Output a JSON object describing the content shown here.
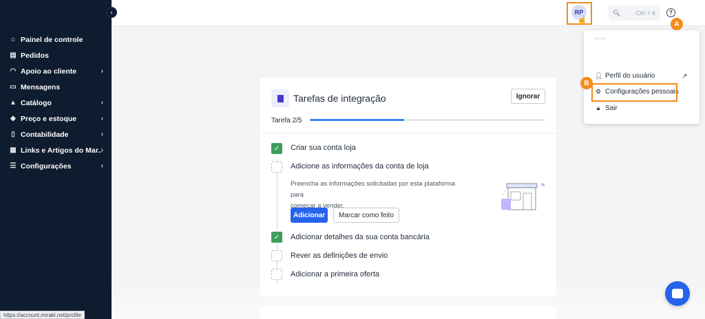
{
  "sidebar": {
    "items": [
      {
        "label": "Painel de controle",
        "icon": "home-icon",
        "glyph": "⌂",
        "chevron": false
      },
      {
        "label": "Pedidos",
        "icon": "clipboard-icon",
        "glyph": "▤",
        "chevron": false
      },
      {
        "label": "Apoio ao cliente",
        "icon": "headset-icon",
        "glyph": "◠",
        "chevron": true
      },
      {
        "label": "Mensagens",
        "icon": "message-icon",
        "glyph": "▭",
        "chevron": false
      },
      {
        "label": "Catálogo",
        "icon": "shapes-icon",
        "glyph": "▲",
        "chevron": true
      },
      {
        "label": "Preço e estoque",
        "icon": "tag-icon",
        "glyph": "◆",
        "chevron": true
      },
      {
        "label": "Contabilidade",
        "icon": "document-icon",
        "glyph": "▯",
        "chevron": true
      },
      {
        "label": "Links e Artigos do Mar...",
        "icon": "grid-icon",
        "glyph": "▦",
        "chevron": true
      },
      {
        "label": "Configurações",
        "icon": "sliders-icon",
        "glyph": "☰",
        "chevron": true
      }
    ],
    "status_url": "https://account.mirakl.net/profile"
  },
  "topbar": {
    "search_shortcut": "Ctrl + k",
    "avatar_initials": "RP"
  },
  "markers": {
    "a": "A",
    "b": "B"
  },
  "dropdown": {
    "profile_label": "Perfil do usuário",
    "settings_label": "Configurações pessoais",
    "logout_label": "Sair"
  },
  "onboarding": {
    "title": "Tarefas de integração",
    "ignore_label": "Ignorar",
    "task_count": "Tarefa 2/5",
    "progress_fraction": 0.4,
    "tasks": [
      {
        "label": "Criar sua conta loja",
        "done": true
      },
      {
        "label": "Adicione as informações da conta de loja",
        "done": false
      },
      {
        "label": "Adicionar detalhes da sua conta bancária",
        "done": true
      },
      {
        "label": "Rever as definições de envio",
        "done": false
      },
      {
        "label": "Adicionar a primeira oferta",
        "done": false
      }
    ],
    "description_line1": "Preencha as informações solicitadas por esta plataforma para",
    "description_line2": "começar a vender.",
    "add_label": "Adicionar",
    "mark_done_label": "Marcar como feito"
  },
  "colors": {
    "accent": "#2563eb",
    "highlight": "#f28c1b",
    "sidebar": "#0f1b2e",
    "done": "#3f9e5e"
  }
}
